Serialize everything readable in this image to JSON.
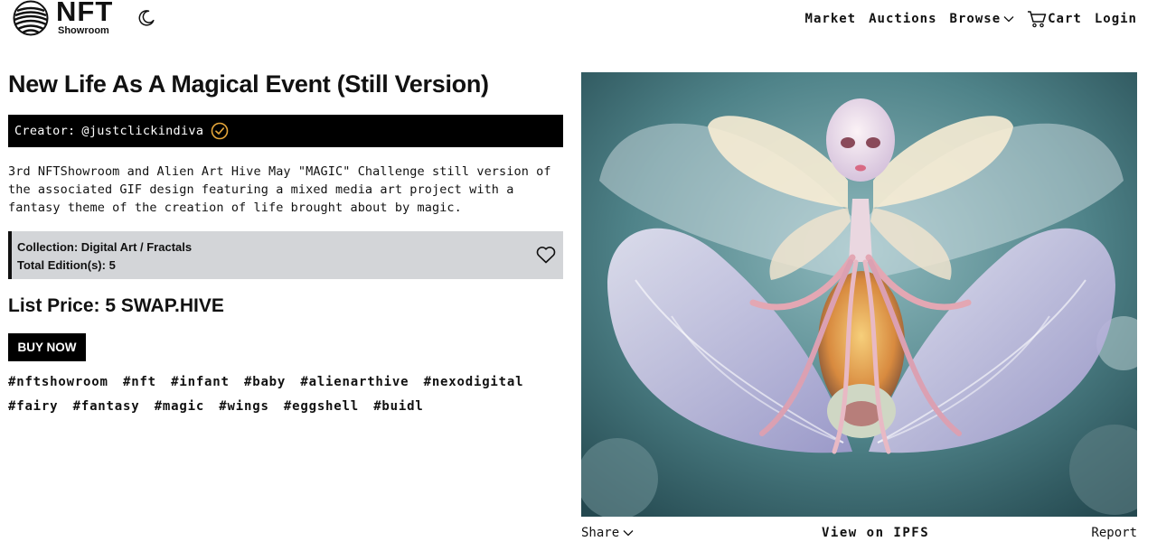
{
  "header": {
    "logo_title": "NFT",
    "logo_subtitle": "Showroom",
    "nav": {
      "market": "Market",
      "auctions": "Auctions",
      "browse": "Browse",
      "cart": "Cart",
      "login": "Login"
    }
  },
  "nft": {
    "title": "New Life As A Magical Event (Still Version)",
    "creator_label": "Creator:",
    "creator_handle": "@justclickindiva",
    "description": "3rd NFTShowroom and Alien Art Hive May \"MAGIC\" Challenge still version of the associated GIF design featuring a mixed media art project with a fantasy theme of the creation of life brought about by magic.",
    "collection": "Collection: Digital Art / Fractals",
    "editions": "Total Edition(s): 5",
    "price": "List Price: 5 SWAP.HIVE",
    "buy_label": "BUY NOW",
    "tags": [
      "#nftshowroom",
      "#nft",
      "#infant",
      "#baby",
      "#alienarthive",
      "#nexodigital",
      "#fairy",
      "#fantasy",
      "#magic",
      "#wings",
      "#eggshell",
      "#buidl"
    ]
  },
  "artwork_footer": {
    "share": "Share",
    "ipfs": "View on IPFS",
    "report": "Report"
  },
  "icons": {
    "logo": "layered-sphere-logo-icon",
    "theme": "moon-icon",
    "cart": "cart-icon",
    "verified": "verified-check-icon",
    "favorite": "heart-icon",
    "dropdown": "chevron-down-icon"
  },
  "colors": {
    "accent": "#000000",
    "collection_bg": "#d3d5d8",
    "text": "#111111"
  }
}
